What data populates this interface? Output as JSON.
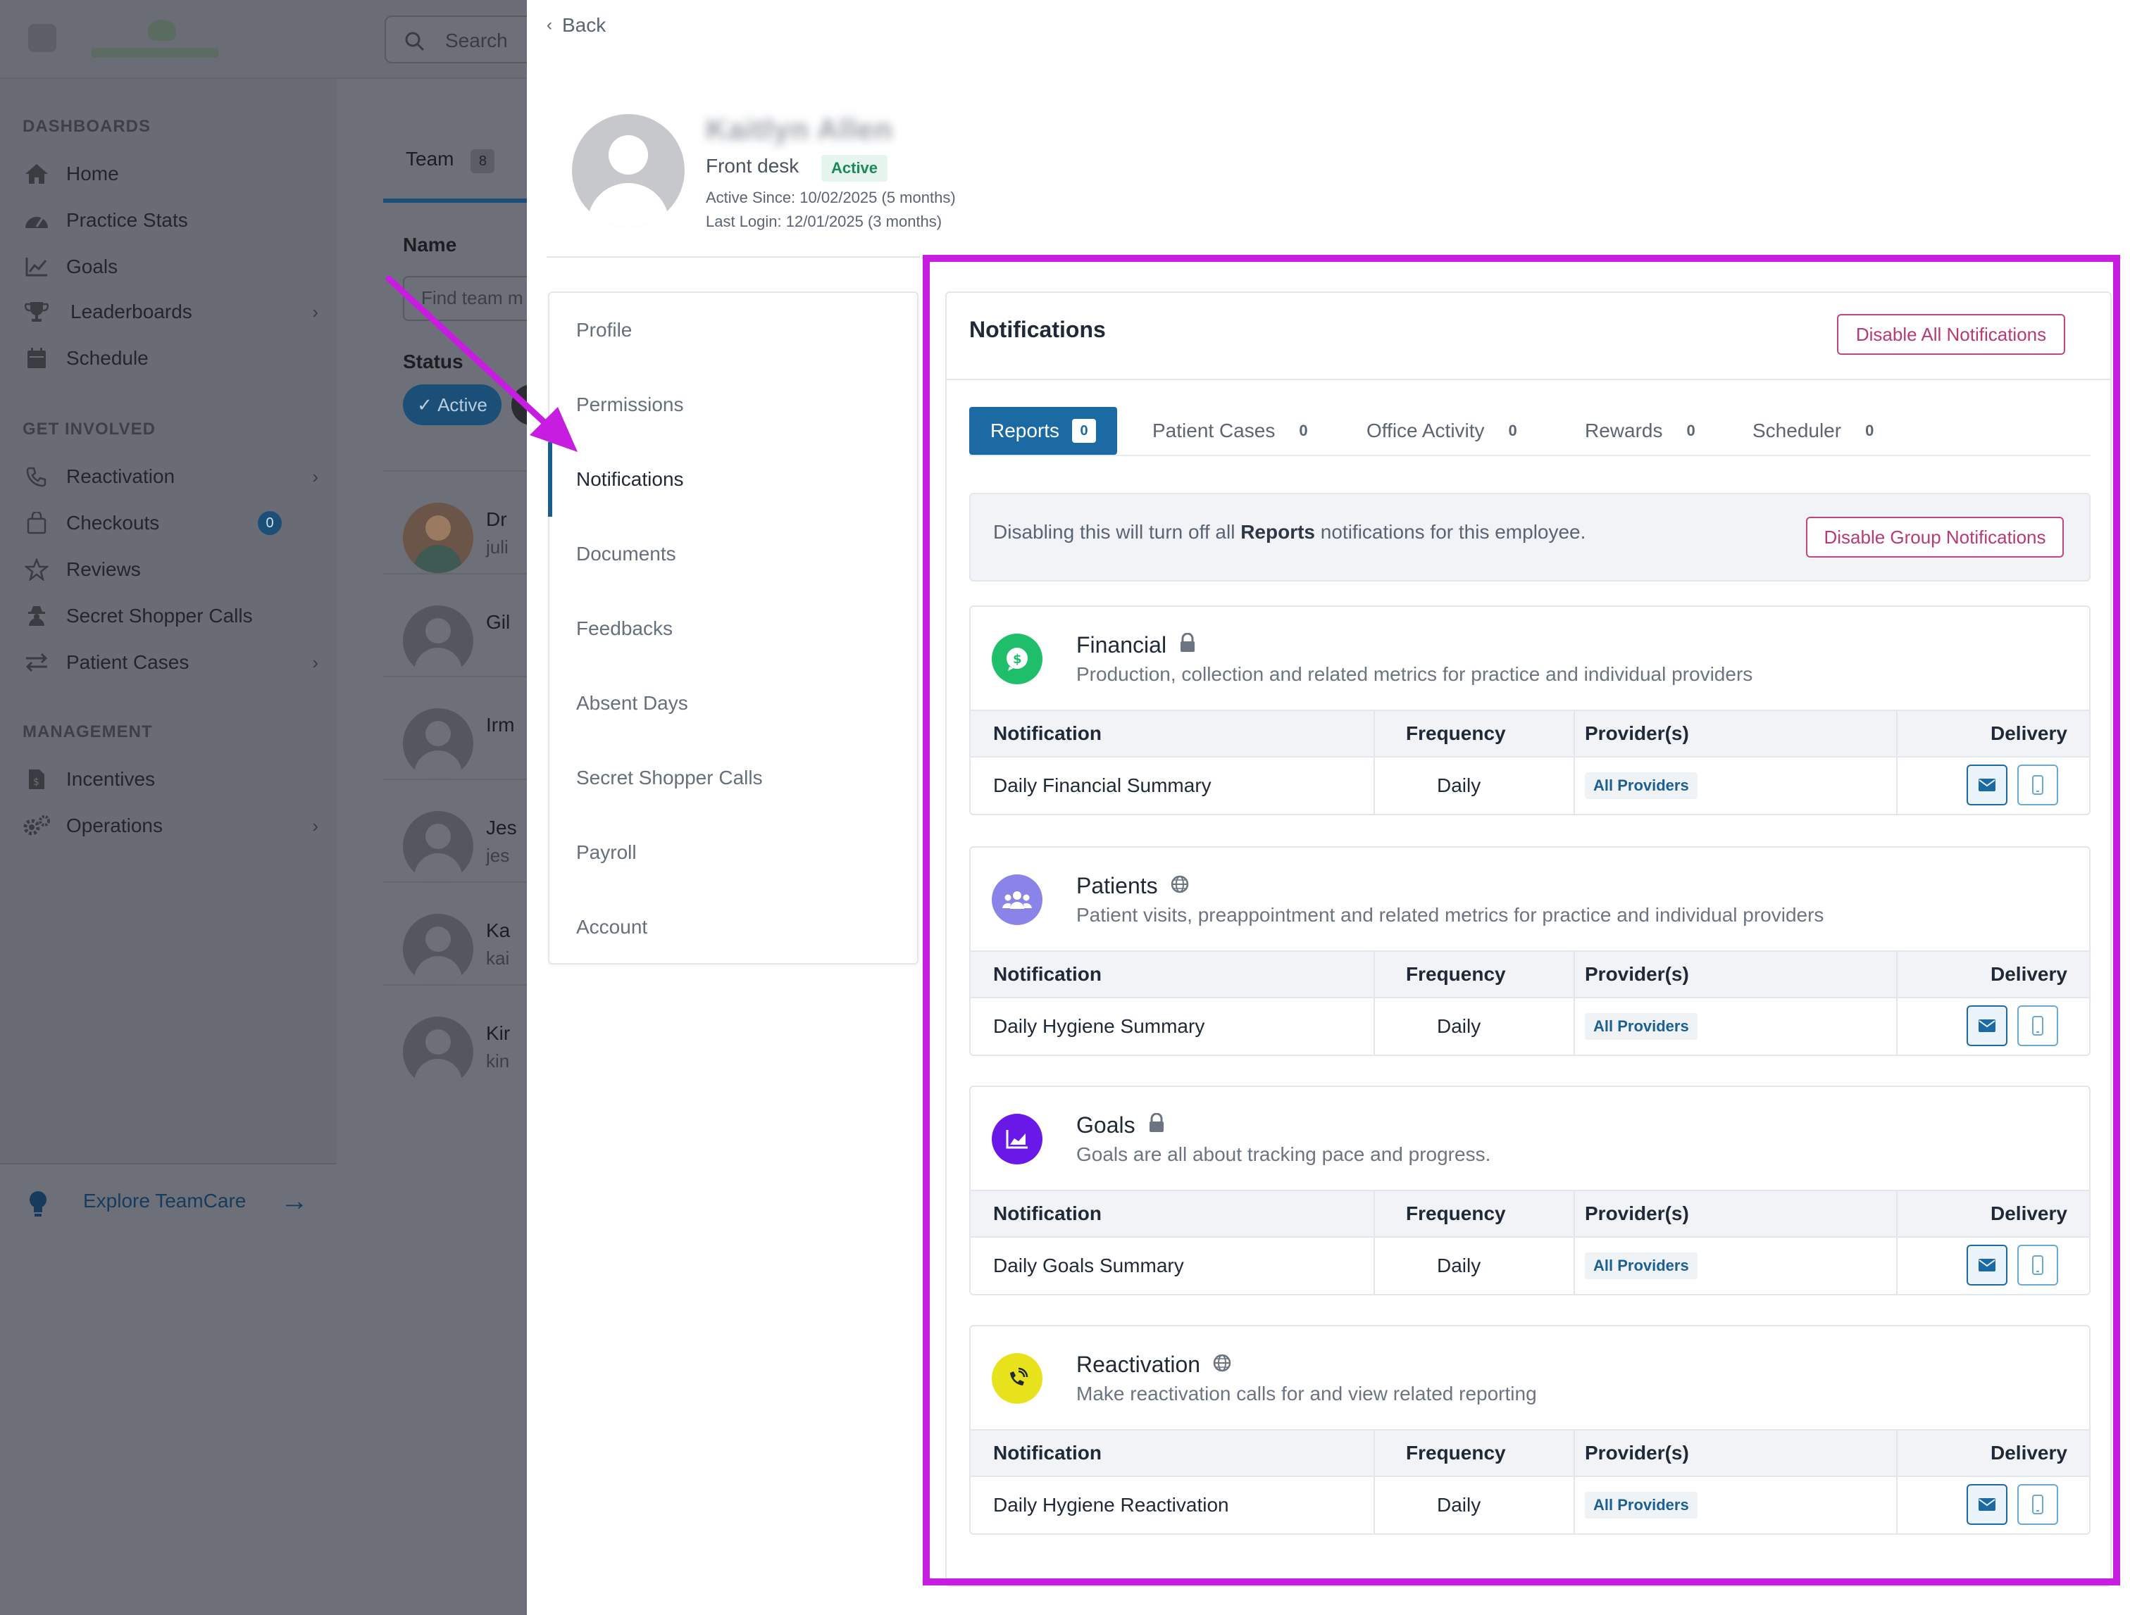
{
  "background_app": {
    "search_placeholder": "Search",
    "sections": [
      {
        "heading": "DASHBOARDS",
        "items": [
          {
            "label": "Home",
            "icon": "home-icon"
          },
          {
            "label": "Practice Stats",
            "icon": "gauge-icon"
          },
          {
            "label": "Goals",
            "icon": "chart-line-icon"
          },
          {
            "label": "Leaderboards",
            "icon": "trophy-icon",
            "has_chevron": true
          },
          {
            "label": "Schedule",
            "icon": "calendar-icon"
          }
        ]
      },
      {
        "heading": "GET INVOLVED",
        "items": [
          {
            "label": "Reactivation",
            "icon": "phone-ring-icon",
            "has_chevron": true
          },
          {
            "label": "Checkouts",
            "icon": "bag-icon",
            "badge": "0"
          },
          {
            "label": "Reviews",
            "icon": "star-icon"
          },
          {
            "label": "Secret Shopper Calls",
            "icon": "user-secret-icon"
          },
          {
            "label": "Patient Cases",
            "icon": "arrows-swap-icon",
            "has_chevron": true
          }
        ]
      },
      {
        "heading": "MANAGEMENT",
        "items": [
          {
            "label": "Incentives",
            "icon": "file-dollar-icon"
          },
          {
            "label": "Operations",
            "icon": "cogs-icon",
            "has_chevron": true
          }
        ]
      }
    ],
    "explore_label": "Explore TeamCare",
    "team_tab": {
      "label": "Team",
      "count": "8"
    },
    "name_label": "Name",
    "find_placeholder": "Find team m",
    "status_label": "Status",
    "status_active": "Active",
    "rows": [
      {
        "name": "Dr",
        "sub": "juli"
      },
      {
        "name": "Gil",
        "sub": ""
      },
      {
        "name": "Irm",
        "sub": ""
      },
      {
        "name": "Jes",
        "sub": "jes"
      },
      {
        "name": "Ka",
        "sub": "kai"
      },
      {
        "name": "Kir",
        "sub": "kin"
      }
    ]
  },
  "drawer": {
    "back_label": "Back",
    "profile": {
      "name": "Kaitlyn Allen",
      "role": "Front desk",
      "status": "Active",
      "active_since": "Active Since: 10/02/2025 (5 months)",
      "last_login": "Last Login: 12/01/2025 (3 months)"
    },
    "menu": [
      {
        "label": "Profile",
        "active": false
      },
      {
        "label": "Permissions",
        "active": false
      },
      {
        "label": "Notifications",
        "active": true
      },
      {
        "label": "Documents",
        "active": false
      },
      {
        "label": "Feedbacks",
        "active": false
      },
      {
        "label": "Absent Days",
        "active": false
      },
      {
        "label": "Secret Shopper Calls",
        "active": false
      },
      {
        "label": "Payroll",
        "active": false
      },
      {
        "label": "Account",
        "active": false
      }
    ],
    "notifications": {
      "title": "Notifications",
      "disable_all_label": "Disable All Notifications",
      "tabs": [
        {
          "label": "Reports",
          "count": "0",
          "active": true
        },
        {
          "label": "Patient Cases",
          "count": "0",
          "active": false
        },
        {
          "label": "Office Activity",
          "count": "0",
          "active": false
        },
        {
          "label": "Rewards",
          "count": "0",
          "active": false
        },
        {
          "label": "Scheduler",
          "count": "0",
          "active": false
        }
      ],
      "group_message_prefix": "Disabling this will turn off all ",
      "group_message_bold": "Reports",
      "group_message_suffix": " notifications for this employee.",
      "disable_group_label": "Disable Group Notifications",
      "columns": {
        "notification": "Notification",
        "frequency": "Frequency",
        "providers": "Provider(s)",
        "delivery": "Delivery"
      },
      "sections": [
        {
          "title": "Financial",
          "title_icon": "lock-icon",
          "icon": "dollar-bubble-icon",
          "icon_color": "#1fbe6a",
          "description": "Production, collection and related metrics for practice and individual providers",
          "row": {
            "notification": "Daily Financial Summary",
            "frequency": "Daily",
            "providers": "All Providers"
          }
        },
        {
          "title": "Patients",
          "title_icon": "globe-icon",
          "icon": "users-icon",
          "icon_color": "#8b84e8",
          "description": "Patient visits, preappointment and related metrics for practice and individual providers",
          "row": {
            "notification": "Daily Hygiene Summary",
            "frequency": "Daily",
            "providers": "All Providers"
          }
        },
        {
          "title": "Goals",
          "title_icon": "lock-icon",
          "icon": "chart-area-icon",
          "icon_color": "#6a18e8",
          "description": "Goals are all about tracking pace and progress.",
          "row": {
            "notification": "Daily Goals Summary",
            "frequency": "Daily",
            "providers": "All Providers"
          }
        },
        {
          "title": "Reactivation",
          "title_icon": "globe-icon",
          "icon": "phone-ring-icon",
          "icon_color": "#e8e21c",
          "description": "Make reactivation calls for and view related reporting",
          "row": {
            "notification": "Daily Hygiene Reactivation",
            "frequency": "Daily",
            "providers": "All Providers"
          }
        }
      ]
    }
  },
  "colors": {
    "accent": "#1c6aa3",
    "danger_outline": "#c2457e",
    "annotation": "#c71de0"
  }
}
